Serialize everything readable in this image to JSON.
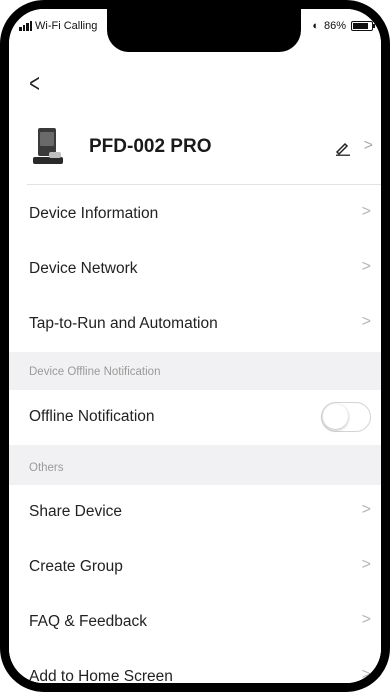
{
  "status_bar": {
    "carrier": "Wi-Fi Calling",
    "battery_percent": "86%",
    "battery_level": 0.86
  },
  "device": {
    "name": "PFD-002 PRO"
  },
  "menu_top": [
    {
      "label": "Device Information"
    },
    {
      "label": "Device Network"
    },
    {
      "label": "Tap-to-Run and Automation"
    }
  ],
  "offline_section": {
    "header": "Device Offline Notification",
    "item_label": "Offline Notification",
    "toggle_on": false
  },
  "others_section": {
    "header": "Others",
    "items": [
      {
        "label": "Share Device"
      },
      {
        "label": "Create Group"
      },
      {
        "label": "FAQ & Feedback"
      },
      {
        "label": "Add to Home Screen"
      }
    ]
  },
  "icons": {
    "back": "chevron-left-icon",
    "edit": "pencil-icon",
    "chevron": "chevron-right-icon"
  }
}
